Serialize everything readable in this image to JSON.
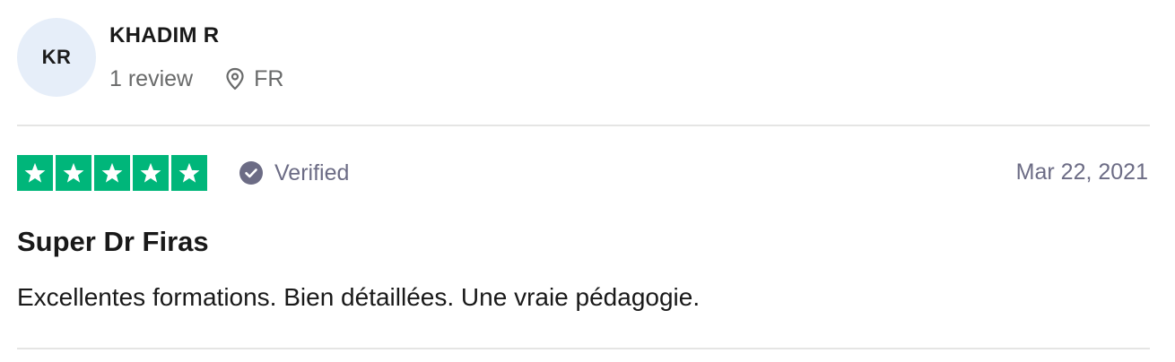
{
  "reviewer": {
    "initials": "KR",
    "name": "KHADIM R",
    "review_count": "1 review",
    "location": "FR"
  },
  "review": {
    "rating": 5,
    "rating_max": 5,
    "verified_label": "Verified",
    "date": "Mar 22, 2021",
    "title": "Super Dr Firas",
    "text": "Excellentes formations. Bien détaillées. Une vraie pédagogie."
  },
  "colors": {
    "star_fill": "#00b67a",
    "avatar_bg": "#e6eef9",
    "muted_text": "#6c6c85"
  },
  "icons": {
    "location": "location-pin-icon",
    "verified": "check-circle-icon",
    "star": "star-icon"
  }
}
